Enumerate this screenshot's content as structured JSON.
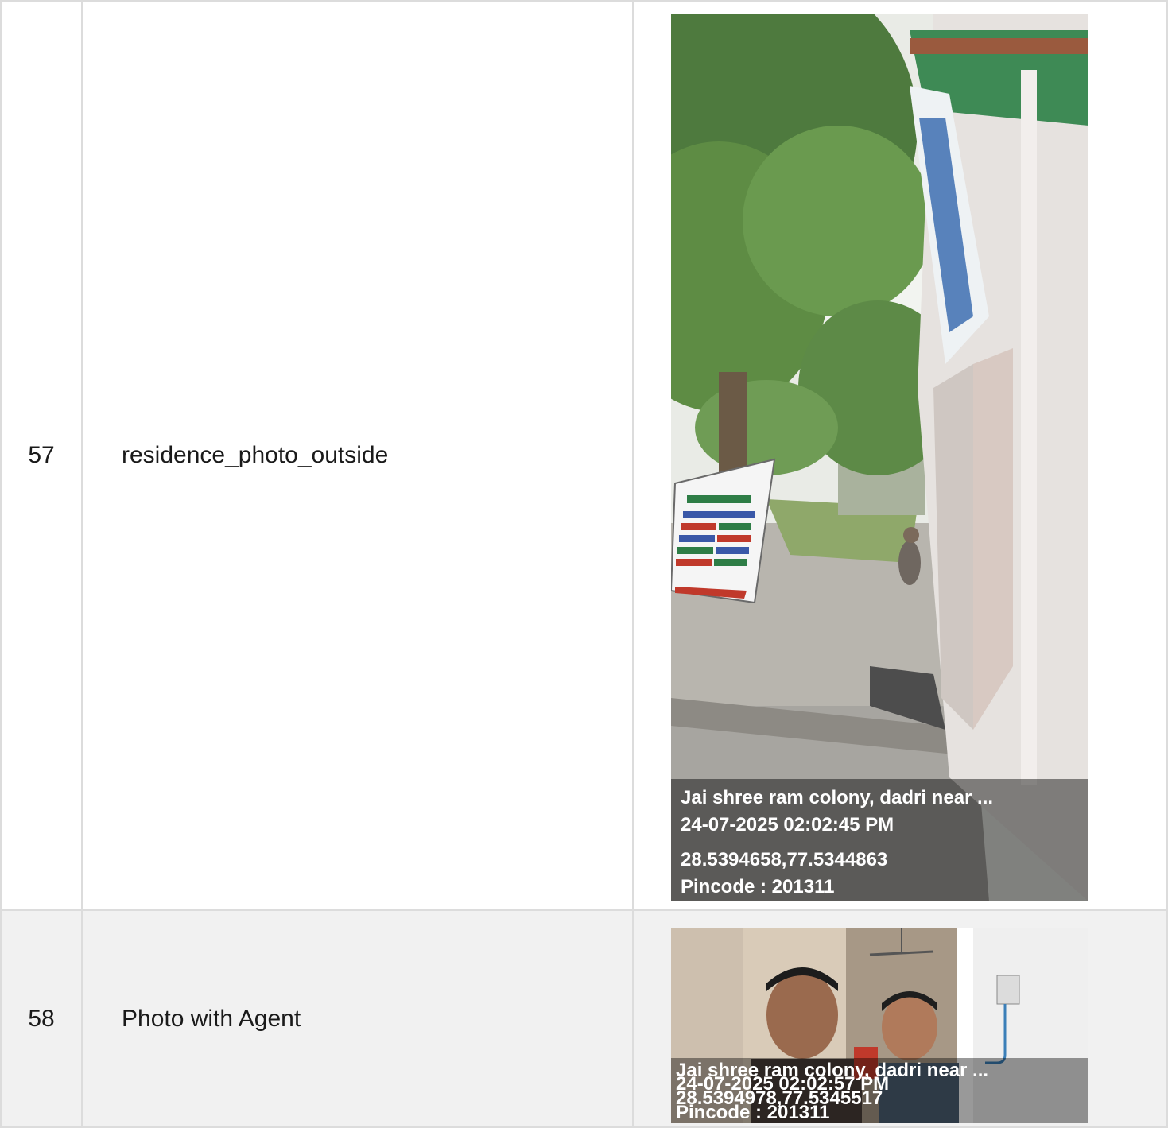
{
  "rows": [
    {
      "number": "57",
      "label": "residence_photo_outside",
      "photo": {
        "address": "Jai shree ram colony, dadri near ...",
        "datetime": "24-07-2025 02:02:45 PM",
        "coords": "28.5394658,77.5344863",
        "pincode": "Pincode : 201311"
      }
    },
    {
      "number": "58",
      "label": "Photo with Agent",
      "photo": {
        "address": "Jai shree ram colony, dadri near ...",
        "datetime": "24-07-2025 02:02:57 PM",
        "coords": "28.5394978,77.5345517",
        "pincode": "Pincode : 201311"
      }
    }
  ]
}
